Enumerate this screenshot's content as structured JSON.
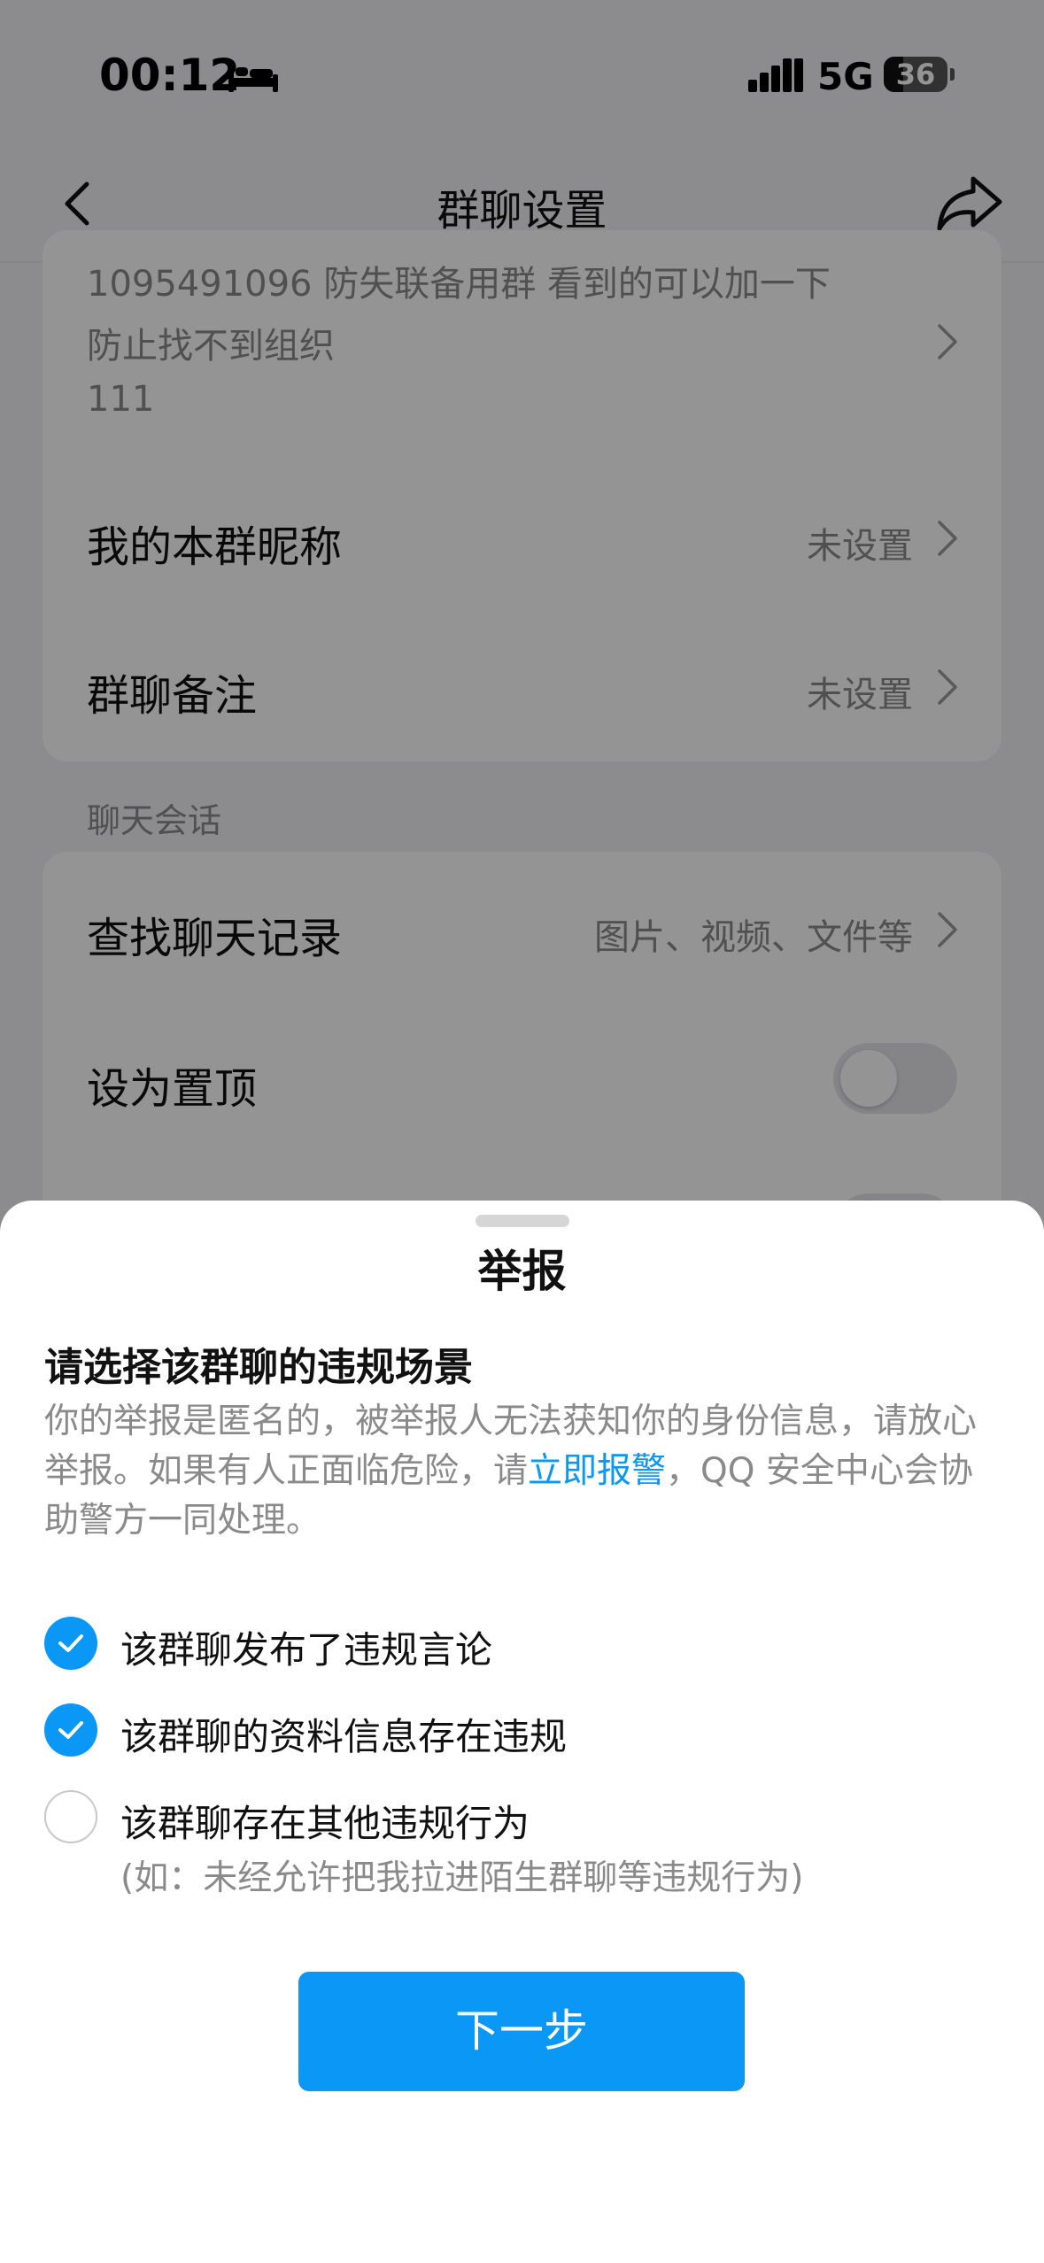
{
  "status_bar": {
    "time": "00:12",
    "network": "5G",
    "battery": "36"
  },
  "nav": {
    "title": "群聊设置"
  },
  "group_info": {
    "notice_lines": [
      "1095491096 防失联备用群 看到的可以加一下",
      "防止找不到组织",
      "111"
    ],
    "nickname": {
      "label": "我的本群昵称",
      "value": "未设置"
    },
    "remark": {
      "label": "群聊备注",
      "value": "未设置"
    }
  },
  "chat_section": {
    "header": "聊天会话",
    "search": {
      "label": "查找聊天记录",
      "value": "图片、视频、文件等"
    },
    "pin": {
      "label": "设为置顶",
      "on": false
    }
  },
  "report_sheet": {
    "title": "举报",
    "prompt": "请选择该群聊的违规场景",
    "desc_before_link": "你的举报是匿名的，被举报人无法获知你的身份信息，请放心举报。如果有人正面临危险，请",
    "desc_link": "立即报警",
    "desc_after_link": "，QQ 安全中心会协助警方一同处理。",
    "options": [
      {
        "label": "该群聊发布了违规言论",
        "checked": true
      },
      {
        "label": "该群聊的资料信息存在违规",
        "checked": true
      },
      {
        "label": "该群聊存在其他违规行为",
        "sub": "(如：未经允许把我拉进陌生群聊等违规行为)",
        "checked": false
      }
    ],
    "next_button": "下一步"
  },
  "colors": {
    "accent": "#0a97f5",
    "overlay": "rgba(0,0,0,0.42)",
    "secondary_text": "#8a8a8a"
  }
}
